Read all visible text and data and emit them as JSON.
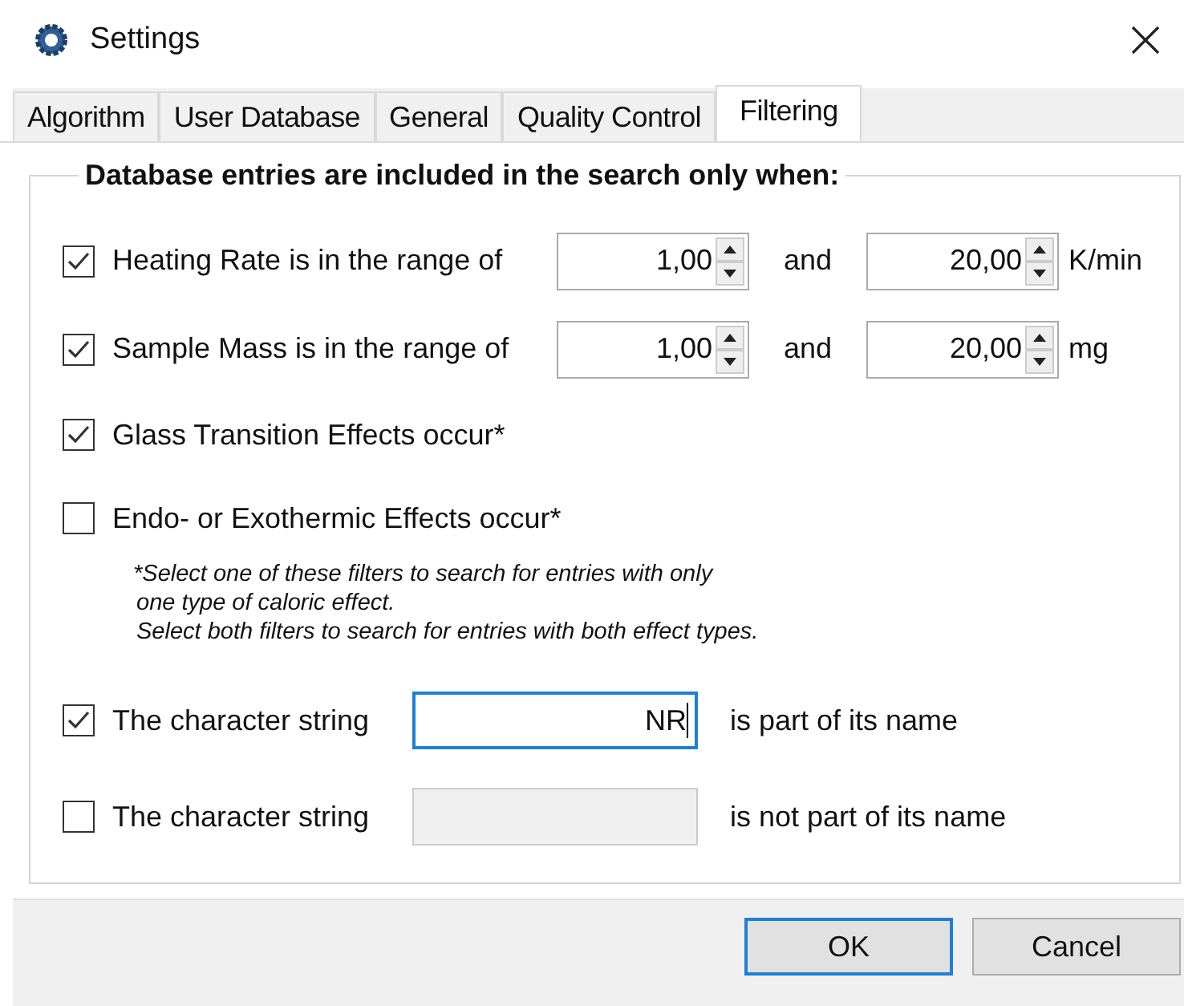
{
  "window": {
    "title": "Settings"
  },
  "tabs": [
    {
      "label": "Algorithm",
      "selected": false
    },
    {
      "label": "User Database",
      "selected": false
    },
    {
      "label": "General",
      "selected": false
    },
    {
      "label": "Quality Control",
      "selected": false
    },
    {
      "label": "Filtering",
      "selected": true
    }
  ],
  "group": {
    "title": "Database entries are included in the search only when:",
    "filters": [
      {
        "kind": "range",
        "label": "Heating Rate is in the range of",
        "checked": true,
        "from": "1,00",
        "joiner": "and",
        "to": "20,00",
        "unit": "K/min"
      },
      {
        "kind": "range",
        "label": "Sample Mass is in the range of",
        "checked": true,
        "from": "1,00",
        "joiner": "and",
        "to": "20,00",
        "unit": "mg"
      },
      {
        "kind": "check",
        "label": "Glass Transition Effects occur*",
        "checked": true
      },
      {
        "kind": "check",
        "label": "Endo- or Exothermic Effects occur*",
        "checked": false
      },
      {
        "kind": "note",
        "lines": [
          "*Select one of these filters to search for entries with only",
          "one type of caloric effect.",
          "Select both filters to search for entries with both effect types."
        ]
      },
      {
        "kind": "text",
        "label": "The character string",
        "checked": true,
        "value": "NR",
        "focused": true,
        "disabled": false,
        "suffix": "is part of its name"
      },
      {
        "kind": "text",
        "label": "The character string",
        "checked": false,
        "focused": false,
        "disabled": true,
        "suffix": "is not part of its name"
      }
    ]
  },
  "buttons": [
    {
      "label": "OK",
      "default": true
    },
    {
      "label": "Cancel",
      "default": false
    }
  ]
}
